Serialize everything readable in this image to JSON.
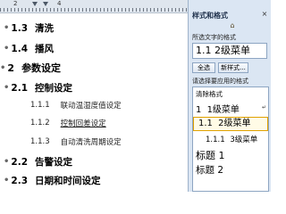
{
  "ruler": {
    "numbers": [
      "2",
      "4"
    ]
  },
  "document": {
    "lines": [
      {
        "num": "1.3",
        "text": "清洗",
        "level": 2
      },
      {
        "num": "1.4",
        "text": "播风",
        "level": 2
      },
      {
        "num": "2",
        "text": "参数设定",
        "level": 1
      },
      {
        "num": "2.1",
        "text": "控制设定",
        "level": 2
      },
      {
        "num": "1.1.1",
        "text": "联动温湿度值设定",
        "level": 3
      },
      {
        "num": "1.1.2",
        "text": "控制回差设定",
        "level": 3,
        "underline": true
      },
      {
        "num": "1.1.3",
        "text": "自动清洗周期设定",
        "level": 3
      },
      {
        "num": "2.2",
        "text": "告警设定",
        "level": 2
      },
      {
        "num": "2.3",
        "text": "日期和时间设定",
        "level": 2
      }
    ]
  },
  "style_pane": {
    "title": "样式和格式",
    "close": "×",
    "selected_label": "所选文字的格式",
    "current_style": {
      "num": "1.1",
      "name": "2级菜单"
    },
    "select_all": "全选",
    "new_style": "新样式...",
    "apply_label": "请选择要应用的格式",
    "list": {
      "clear": "清除格式",
      "item1": {
        "num": "1",
        "name": "1级菜单"
      },
      "item2": {
        "num": "1.1",
        "name": "2级菜单"
      },
      "item3": {
        "num": "1.1.1",
        "name": "3级菜单"
      },
      "heading1": "标题 1",
      "heading2": "标题 2"
    }
  }
}
